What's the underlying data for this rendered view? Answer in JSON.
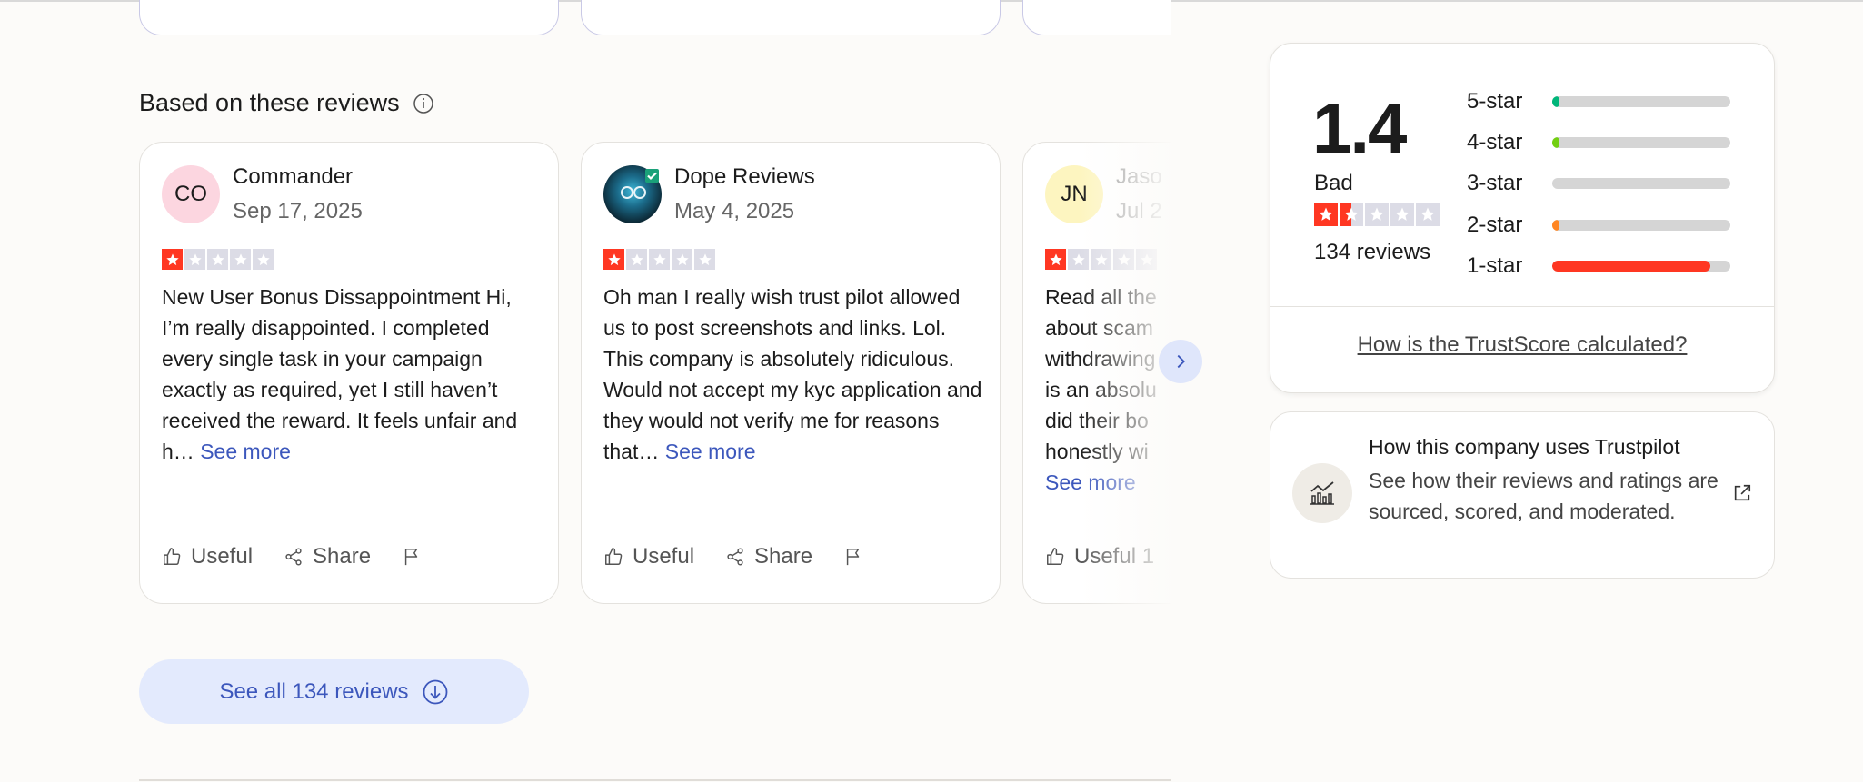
{
  "section": {
    "title": "Based on these reviews"
  },
  "reviews": [
    {
      "initials": "CO",
      "name": "Commander",
      "date": "Sep 17, 2025",
      "rating": 1,
      "text": "New User Bonus Dissappointment Hi, I’m really disappointed. I completed every single task in your campaign exactly as required, yet I still haven’t received the reward. It feels unfair and h…",
      "see_more": "See more",
      "useful_label": "Useful",
      "share_label": "Share",
      "avatar_color": "#fcd6e0"
    },
    {
      "initials": "",
      "name": "Dope Reviews",
      "date": "May 4, 2025",
      "rating": 1,
      "text": "Oh man I really wish trust pilot allowed us to post screenshots and links. Lol. This company is absolutely ridiculous. Would not accept my kyc application and they would not verify me for reasons that…",
      "see_more": "See more",
      "useful_label": "Useful",
      "share_label": "Share"
    },
    {
      "initials": "JN",
      "name": "Jaso",
      "date": "Jul 2",
      "rating": 1,
      "text": "Read all the about scam withdrawing is an absolu did their bo honestly wi",
      "see_more": "See more",
      "useful_label": "Useful 1",
      "avatar_color": "#fdf5c0"
    }
  ],
  "see_all": {
    "label": "See all 134 reviews"
  },
  "summary": {
    "score": "1.4",
    "label": "Bad",
    "count_label": "134 reviews",
    "distribution": [
      {
        "label": "5-star",
        "fraction": 0.04,
        "color": "#00b67a"
      },
      {
        "label": "4-star",
        "fraction": 0.03,
        "color": "#73cf11"
      },
      {
        "label": "3-star",
        "fraction": 0.0,
        "color": "#ffce00"
      },
      {
        "label": "2-star",
        "fraction": 0.04,
        "color": "#ff8622"
      },
      {
        "label": "1-star",
        "fraction": 0.89,
        "color": "#ff3722"
      }
    ],
    "calc_link": "How is the TrustScore calculated?"
  },
  "uses": {
    "title": "How this company uses Trustpilot",
    "description": "See how their reviews and ratings are sourced, scored, and moderated."
  },
  "icons": {
    "info": "info-icon",
    "next": "chevron-right-icon",
    "useful": "thumbs-up-icon",
    "share": "share-icon",
    "flag": "flag-icon",
    "download": "arrow-down-circle-icon",
    "chart": "chart-icon",
    "external": "external-link-icon"
  }
}
